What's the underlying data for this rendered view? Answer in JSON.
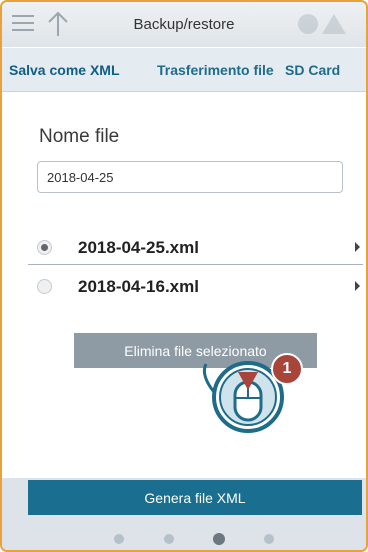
{
  "header": {
    "title": "Backup/restore",
    "menu_icon": "hamburger-menu-icon",
    "up_icon": "up-arrow-icon"
  },
  "tabs": [
    {
      "label": "Salva come XML",
      "active": true
    },
    {
      "label": "Trasferimento file",
      "active": false
    },
    {
      "label": "SD Card",
      "active": false
    }
  ],
  "form": {
    "filename_label": "Nome file",
    "filename_value": "2018-04-25"
  },
  "files": [
    {
      "name": "2018-04-25.xml",
      "selected": true
    },
    {
      "name": "2018-04-16.xml",
      "selected": false
    }
  ],
  "buttons": {
    "delete_label": "Elimina file selezionato",
    "generate_label": "Genera file XML"
  },
  "tap_hint": {
    "step": "1",
    "icon": "mouse-click-icon"
  },
  "pager": {
    "count": 4,
    "active_index": 2
  },
  "colors": {
    "frame": "#e9a23b",
    "tab_text": "#1f6b8a",
    "primary_button": "#1a6e8f",
    "disabled_button": "#8e9aa4",
    "badge": "#a8443a"
  }
}
